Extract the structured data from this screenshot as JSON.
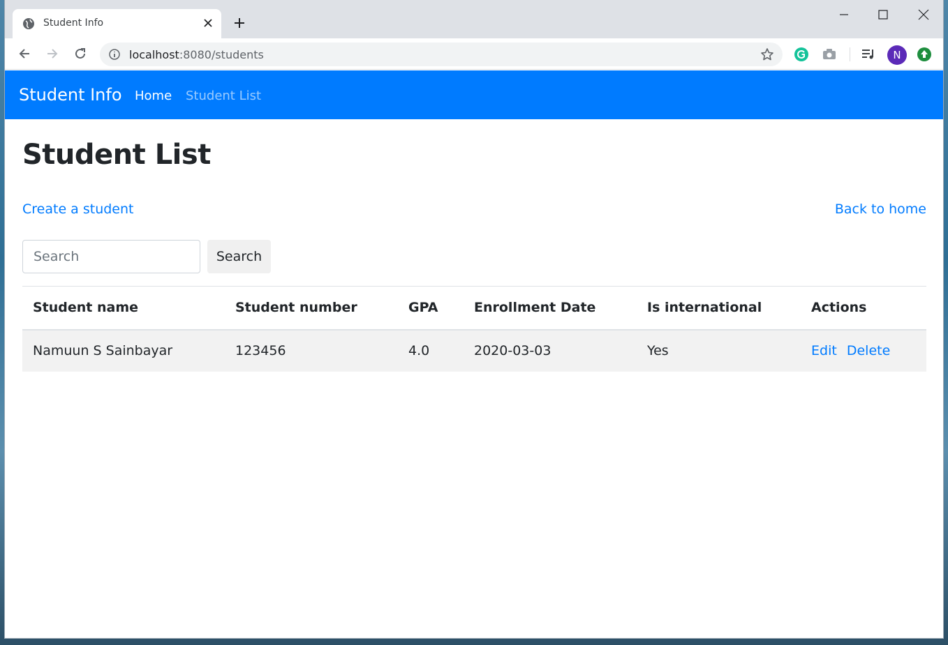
{
  "browser": {
    "tab_title": "Student Info",
    "url_host": "localhost",
    "url_path": ":8080/students",
    "avatar_letter": "N"
  },
  "navbar": {
    "brand": "Student Info",
    "links": [
      "Home",
      "Student List"
    ]
  },
  "main": {
    "title": "Student List",
    "create_link": "Create a student",
    "back_link": "Back to home",
    "search": {
      "placeholder": "Search",
      "value": "",
      "button_label": "Search"
    }
  },
  "table": {
    "headers": [
      "Student name",
      "Student number",
      "GPA",
      "Enrollment Date",
      "Is international",
      "Actions"
    ],
    "rows": [
      {
        "name": "Namuun S Sainbayar",
        "number": "123456",
        "gpa": "4.0",
        "enrollment_date": "2020-03-03",
        "is_international": "Yes",
        "actions": [
          "Edit",
          "Delete"
        ]
      }
    ]
  },
  "colors": {
    "navbar_bg": "#007bff",
    "link": "#007bff",
    "row_bg": "#f2f2f2"
  }
}
